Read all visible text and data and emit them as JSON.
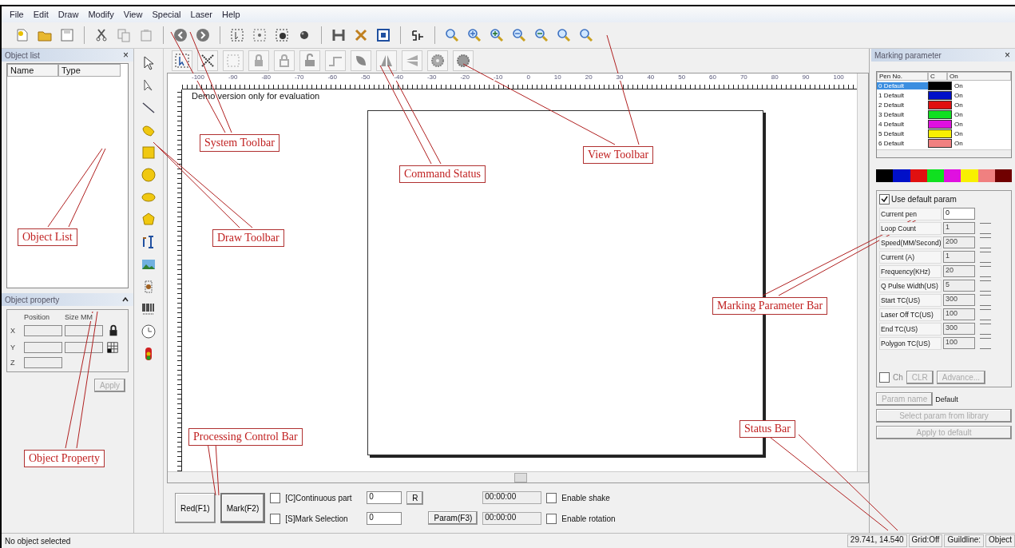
{
  "menu": [
    "File",
    "Edit",
    "Draw",
    "Modify",
    "View",
    "Special",
    "Laser",
    "Help"
  ],
  "object_list": {
    "title": "Object list",
    "close": "×",
    "columns": [
      "Name",
      "Type"
    ]
  },
  "object_property": {
    "title": "Object property",
    "headers": [
      "Position",
      "Size MM"
    ],
    "axes": [
      "X",
      "Y",
      "Z"
    ],
    "apply": {
      "label": "Apply",
      "disabled": true
    }
  },
  "canvas": {
    "notice": "Demo version only for evaluation",
    "ruler_labels": [
      "-100",
      "-90",
      "-80",
      "-70",
      "-60",
      "-50",
      "-40",
      "-30",
      "-20",
      "-10",
      "0",
      "10",
      "20",
      "30",
      "40",
      "50",
      "60",
      "70",
      "80",
      "90",
      "100"
    ]
  },
  "processing": {
    "red_button": "Red(F1)",
    "mark_button": "Mark(F2)",
    "param_button": "Param(F3)",
    "options": [
      {
        "label": "[C]Continuous part",
        "checked": false,
        "value": "0"
      },
      {
        "label": "[S]Mark Selection",
        "checked": false,
        "value": "0"
      }
    ],
    "r_button": "R",
    "times": [
      "00:00:00",
      "00:00:00"
    ],
    "switches": [
      {
        "label": "Enable shake",
        "checked": false
      },
      {
        "label": "Enable rotation",
        "checked": false
      }
    ]
  },
  "marking": {
    "title": "Marking parameter",
    "close": "×",
    "pen_columns": [
      "Pen No.",
      "C",
      "On"
    ],
    "pens": [
      {
        "label": "0 Default",
        "color": "#000000",
        "on": "On",
        "selected": true
      },
      {
        "label": "1 Default",
        "color": "#0010c8",
        "on": "On",
        "selected": false
      },
      {
        "label": "2 Default",
        "color": "#e01010",
        "on": "On",
        "selected": false
      },
      {
        "label": "3 Default",
        "color": "#10e020",
        "on": "On",
        "selected": false
      },
      {
        "label": "4 Default",
        "color": "#e010e0",
        "on": "On",
        "selected": false
      },
      {
        "label": "5 Default",
        "color": "#f8f000",
        "on": "On",
        "selected": false
      },
      {
        "label": "6 Default",
        "color": "#f08080",
        "on": "On",
        "selected": false
      }
    ],
    "palette": [
      {
        "color": "#000000"
      },
      {
        "color": "#0010c8"
      },
      {
        "color": "#e01010"
      },
      {
        "color": "#10e020"
      },
      {
        "color": "#e010e0"
      },
      {
        "color": "#f8f000"
      },
      {
        "color": "#f08080"
      },
      {
        "color": "#700000"
      }
    ],
    "use_default": {
      "label": "Use default param",
      "checked": true
    },
    "params": [
      {
        "label": "Current pen",
        "value": "0",
        "kind": "plain",
        "disabled": false
      },
      {
        "label": "Loop Count",
        "value": "1",
        "kind": "spin",
        "disabled": true
      },
      {
        "label": "Speed(MM/Second)",
        "value": "200",
        "kind": "spin",
        "disabled": true
      },
      {
        "label": "Current (A)",
        "value": "1",
        "kind": "spin",
        "disabled": true
      },
      {
        "label": "Frequency(KHz)",
        "value": "20",
        "kind": "spin",
        "disabled": true
      },
      {
        "label": "Q Pulse Width(US)",
        "value": "5",
        "kind": "spin",
        "disabled": true
      },
      {
        "label": "Start TC(US)",
        "value": "300",
        "kind": "spin",
        "disabled": true
      },
      {
        "label": "Laser Off TC(US)",
        "value": "100",
        "kind": "spin",
        "disabled": true
      },
      {
        "label": "End TC(US)",
        "value": "300",
        "kind": "spin",
        "disabled": true
      },
      {
        "label": "Polygon TC(US)",
        "value": "100",
        "kind": "spin",
        "disabled": true
      }
    ],
    "extra": {
      "checkbox": {
        "label": "Ch",
        "checked": false
      },
      "clr_button": "CLR",
      "advance_button": "Advance..."
    },
    "param_name": {
      "label": "Param name",
      "value": "Default"
    },
    "buttons": [
      {
        "label": "Select param from library",
        "disabled": true
      },
      {
        "label": "Apply to default",
        "disabled": true
      }
    ]
  },
  "status_bar": {
    "message": "No object selected",
    "coords": "29.741, 14.540",
    "grid": "Grid:Off",
    "guideline": "Guildline:",
    "object": "Object"
  },
  "callouts": [
    {
      "label": "System Toolbar"
    },
    {
      "label": "Command Status"
    },
    {
      "label": "View Toolbar"
    },
    {
      "label": "Object List"
    },
    {
      "label": "Draw Toolbar"
    },
    {
      "label": "Marking Parameter Bar"
    },
    {
      "label": "Processing Control Bar"
    },
    {
      "label": "Object Property"
    },
    {
      "label": "Status Bar"
    }
  ]
}
